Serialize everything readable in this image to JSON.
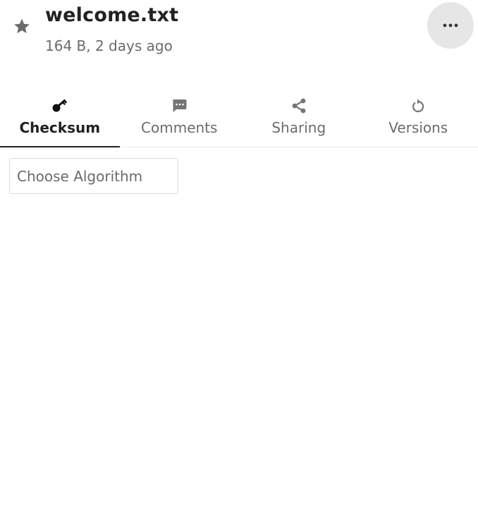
{
  "header": {
    "title": "welcome.txt",
    "subtitle": "164 B, 2 days ago",
    "star_icon": "star-icon",
    "menu_icon": "more-horizontal-icon"
  },
  "tabs": [
    {
      "label": "Checksum",
      "icon": "key-icon",
      "active": true
    },
    {
      "label": "Comments",
      "icon": "comment-icon",
      "active": false
    },
    {
      "label": "Sharing",
      "icon": "share-icon",
      "active": false
    },
    {
      "label": "Versions",
      "icon": "history-icon",
      "active": false
    }
  ],
  "checksum": {
    "algorithm_placeholder": "Choose Algorithm",
    "algorithm_value": ""
  },
  "colors": {
    "text_primary": "#222222",
    "text_secondary": "#6b6b6b",
    "menu_button_bg": "#e6e6e6",
    "icon_gray": "#757575"
  }
}
